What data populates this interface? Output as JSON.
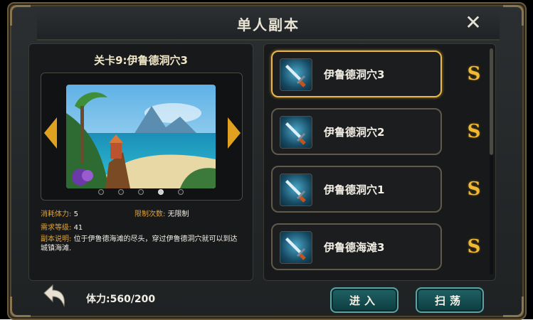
{
  "window": {
    "title": "单人副本",
    "close_icon": "close-icon"
  },
  "left": {
    "stage_title": "关卡9:伊鲁德洞穴3",
    "carousel": {
      "page_count": 5,
      "active_page": 4
    },
    "info": {
      "stamina_cost_label": "消耗体力:",
      "stamina_cost_value": "5",
      "limit_label": "限制次数:",
      "limit_value": "无限制",
      "level_label": "需求等级:",
      "level_value": "41",
      "desc_label": "副本说明:",
      "desc_text": "位于伊鲁德海滩的尽头，穿过伊鲁德洞穴就可以到达城镇海滩."
    }
  },
  "stages": [
    {
      "label": "伊鲁德洞穴3",
      "selected": true,
      "icon": "sword-icon",
      "sweep_icon": "sweep-s-icon"
    },
    {
      "label": "伊鲁德洞穴2",
      "selected": false,
      "icon": "sword-icon",
      "sweep_icon": "sweep-s-icon"
    },
    {
      "label": "伊鲁德洞穴1",
      "selected": false,
      "icon": "sword-icon",
      "sweep_icon": "sweep-s-icon"
    },
    {
      "label": "伊鲁德海滩3",
      "selected": false,
      "icon": "sword-icon",
      "sweep_icon": "sweep-s-icon"
    }
  ],
  "bottom": {
    "stamina_text": "体力:560/200",
    "enter_label": "进入",
    "sweep_label": "扫荡"
  },
  "colors": {
    "accent_gold": "#e8b64a",
    "button_teal": "#1f6366",
    "label_orange": "#e0a33a"
  }
}
